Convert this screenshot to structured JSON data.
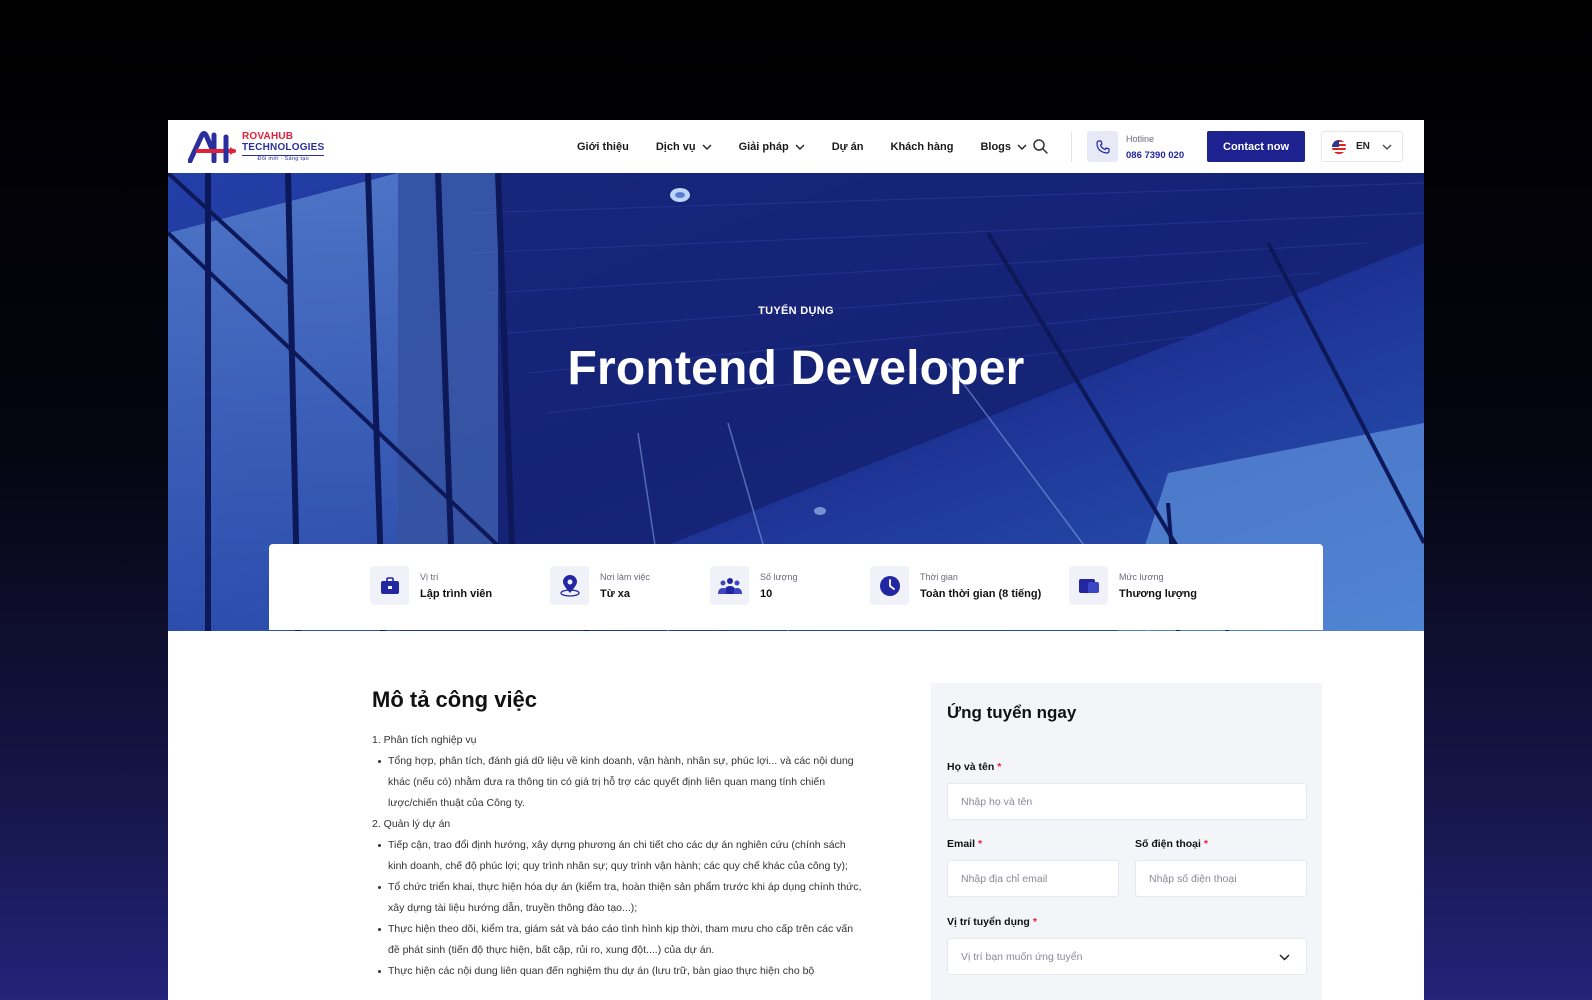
{
  "brand": {
    "line1": "ROVAHUB",
    "line2": "TECHNOLOGIES",
    "tagline": "Đổi mới · Sáng tạo"
  },
  "nav": {
    "items": [
      {
        "label": "Giới thiệu",
        "dropdown": false
      },
      {
        "label": "Dịch vụ",
        "dropdown": true
      },
      {
        "label": "Giải pháp",
        "dropdown": true
      },
      {
        "label": "Dự án",
        "dropdown": false
      },
      {
        "label": "Khách hàng",
        "dropdown": false
      },
      {
        "label": "Blogs",
        "dropdown": true
      }
    ],
    "search_icon": "search-icon"
  },
  "hotline": {
    "label": "Hotline",
    "number": "086 7390 020",
    "icon": "phone-icon"
  },
  "contact_button": "Contact now",
  "language": {
    "code": "EN",
    "icon": "us-flag-icon"
  },
  "hero": {
    "kicker": "TUYỂN DỤNG",
    "title": "Frontend Developer"
  },
  "job_info": [
    {
      "label": "Vị trí",
      "value": "Lập trình viên",
      "icon": "briefcase-icon"
    },
    {
      "label": "Nơi làm việc",
      "value": "Từ xa",
      "icon": "map-pin-icon"
    },
    {
      "label": "Số lượng",
      "value": "10",
      "icon": "people-icon"
    },
    {
      "label": "Thời gian",
      "value": "Toàn thời gian (8 tiếng)",
      "icon": "clock-icon"
    },
    {
      "label": "Mức lương",
      "value": "Thương lượng",
      "icon": "wallet-icon"
    }
  ],
  "description": {
    "title": "Mô tả công việc",
    "sections": [
      {
        "heading": "1. Phân tích nghiệp vụ",
        "bullets": [
          "Tổng hợp, phân tích, đánh giá dữ liệu về kinh doanh, vận hành, nhân sự, phúc lợi... và các nội dung khác (nếu có) nhằm đưa ra thông tin có giá trị hỗ trợ các quyết định liên quan mang tính chiến lược/chiến thuật của Công ty."
        ]
      },
      {
        "heading": "2. Quản lý dự án",
        "bullets": [
          "Tiếp cận, trao đổi định hướng, xây dựng phương án chi tiết cho các dự án nghiên cứu (chính sách kinh doanh, chế độ phúc lợi; quy trình nhân sự; quy trình vận hành; các quy chế khác của công ty);",
          "Tổ chức triển khai, thực hiện hóa dự án (kiểm tra, hoàn thiện sản phẩm trước khi áp dụng chính thức, xây dựng tài liệu hướng dẫn, truyền thông đào tạo...);",
          "Thực hiện theo dõi, kiểm tra, giám sát và báo cáo tình hình kịp thời, tham mưu cho cấp trên các vấn đề phát sinh (tiến độ thực hiện, bất cập, rủi ro, xung đột....) của dự án.",
          "Thực hiện các nội dung liên quan đến nghiệm thu dự án (lưu trữ, bàn giao thực hiện cho bộ"
        ]
      }
    ]
  },
  "form": {
    "title": "Ứng tuyển ngay",
    "required_mark": "*",
    "fullname": {
      "label": "Họ và tên",
      "placeholder": "Nhập họ và tên"
    },
    "email": {
      "label": "Email",
      "placeholder": "Nhập địa chỉ email"
    },
    "phone": {
      "label": "Số điện thoại",
      "placeholder": "Nhập số điện thoại"
    },
    "position": {
      "label": "Vị trí tuyển dụng",
      "placeholder": "Vị trí bạn muốn ứng tuyển"
    }
  },
  "colors": {
    "primary": "#1e2190",
    "accent_red": "#e2213a",
    "hero_blue": "#1b2a8a"
  }
}
